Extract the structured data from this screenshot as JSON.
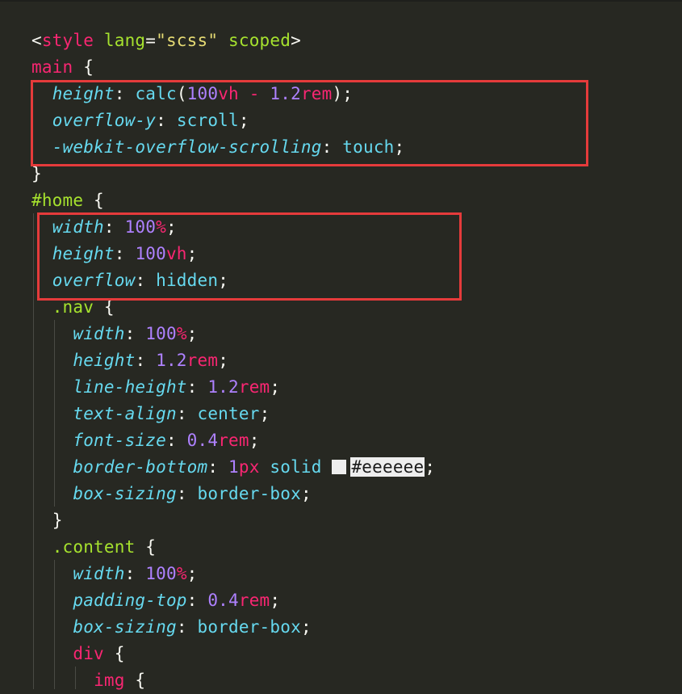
{
  "editor": {
    "colors": {
      "background": "#272822",
      "highlight_box": "#e53b3b",
      "swatch": "#eeeeee"
    },
    "lines": [
      [
        {
          "t": "<",
          "c": "punc"
        },
        {
          "t": "style",
          "c": "tag"
        },
        {
          "t": " ",
          "c": "punc"
        },
        {
          "t": "lang",
          "c": "attr"
        },
        {
          "t": "=",
          "c": "punc"
        },
        {
          "t": "\"scss\"",
          "c": "str"
        },
        {
          "t": " ",
          "c": "punc"
        },
        {
          "t": "scoped",
          "c": "attr"
        },
        {
          "t": ">",
          "c": "punc"
        }
      ],
      [
        {
          "t": "main",
          "c": "sel"
        },
        {
          "t": " {",
          "c": "punc"
        }
      ],
      [
        {
          "t": "  ",
          "c": "punc"
        },
        {
          "t": "height",
          "c": "prop"
        },
        {
          "t": ": ",
          "c": "punc"
        },
        {
          "t": "calc",
          "c": "kw"
        },
        {
          "t": "(",
          "c": "punc"
        },
        {
          "t": "100",
          "c": "num"
        },
        {
          "t": "vh",
          "c": "unit"
        },
        {
          "t": " - ",
          "c": "op"
        },
        {
          "t": "1.2",
          "c": "num"
        },
        {
          "t": "rem",
          "c": "unit"
        },
        {
          "t": ");",
          "c": "punc"
        }
      ],
      [
        {
          "t": "  ",
          "c": "punc"
        },
        {
          "t": "overflow-y",
          "c": "prop"
        },
        {
          "t": ": ",
          "c": "punc"
        },
        {
          "t": "scroll",
          "c": "kw"
        },
        {
          "t": ";",
          "c": "punc"
        }
      ],
      [
        {
          "t": "  ",
          "c": "punc"
        },
        {
          "t": "-webkit-overflow-scrolling",
          "c": "prop"
        },
        {
          "t": ": ",
          "c": "punc"
        },
        {
          "t": "touch",
          "c": "kw"
        },
        {
          "t": ";",
          "c": "punc"
        }
      ],
      [
        {
          "t": "}",
          "c": "punc"
        }
      ],
      [
        {
          "t": "#home",
          "c": "id"
        },
        {
          "t": " {",
          "c": "punc"
        }
      ],
      [
        {
          "t": "  ",
          "c": "punc"
        },
        {
          "t": "width",
          "c": "prop"
        },
        {
          "t": ": ",
          "c": "punc"
        },
        {
          "t": "100",
          "c": "num"
        },
        {
          "t": "%",
          "c": "unit"
        },
        {
          "t": ";",
          "c": "punc"
        }
      ],
      [
        {
          "t": "  ",
          "c": "punc"
        },
        {
          "t": "height",
          "c": "prop"
        },
        {
          "t": ": ",
          "c": "punc"
        },
        {
          "t": "100",
          "c": "num"
        },
        {
          "t": "vh",
          "c": "unit"
        },
        {
          "t": ";",
          "c": "punc"
        }
      ],
      [
        {
          "t": "  ",
          "c": "punc"
        },
        {
          "t": "overflow",
          "c": "prop"
        },
        {
          "t": ": ",
          "c": "punc"
        },
        {
          "t": "hidden",
          "c": "kw"
        },
        {
          "t": ";",
          "c": "punc"
        }
      ],
      [
        {
          "t": "  ",
          "c": "punc"
        },
        {
          "t": ".nav",
          "c": "cls"
        },
        {
          "t": " {",
          "c": "punc"
        }
      ],
      [
        {
          "t": "    ",
          "c": "punc"
        },
        {
          "t": "width",
          "c": "prop"
        },
        {
          "t": ": ",
          "c": "punc"
        },
        {
          "t": "100",
          "c": "num"
        },
        {
          "t": "%",
          "c": "unit"
        },
        {
          "t": ";",
          "c": "punc"
        }
      ],
      [
        {
          "t": "    ",
          "c": "punc"
        },
        {
          "t": "height",
          "c": "prop"
        },
        {
          "t": ": ",
          "c": "punc"
        },
        {
          "t": "1.2",
          "c": "num"
        },
        {
          "t": "rem",
          "c": "unit"
        },
        {
          "t": ";",
          "c": "punc"
        }
      ],
      [
        {
          "t": "    ",
          "c": "punc"
        },
        {
          "t": "line-height",
          "c": "prop"
        },
        {
          "t": ": ",
          "c": "punc"
        },
        {
          "t": "1.2",
          "c": "num"
        },
        {
          "t": "rem",
          "c": "unit"
        },
        {
          "t": ";",
          "c": "punc"
        }
      ],
      [
        {
          "t": "    ",
          "c": "punc"
        },
        {
          "t": "text-align",
          "c": "prop"
        },
        {
          "t": ": ",
          "c": "punc"
        },
        {
          "t": "center",
          "c": "kw"
        },
        {
          "t": ";",
          "c": "punc"
        }
      ],
      [
        {
          "t": "    ",
          "c": "punc"
        },
        {
          "t": "font-size",
          "c": "prop"
        },
        {
          "t": ": ",
          "c": "punc"
        },
        {
          "t": "0.4",
          "c": "num"
        },
        {
          "t": "rem",
          "c": "unit"
        },
        {
          "t": ";",
          "c": "punc"
        }
      ],
      [
        {
          "t": "    ",
          "c": "punc"
        },
        {
          "t": "border-bottom",
          "c": "prop"
        },
        {
          "t": ": ",
          "c": "punc"
        },
        {
          "t": "1",
          "c": "num"
        },
        {
          "t": "px",
          "c": "unit"
        },
        {
          "t": " ",
          "c": "punc"
        },
        {
          "t": "solid",
          "c": "kw"
        },
        {
          "t": " ",
          "c": "punc"
        },
        {
          "t": "",
          "c": "swatch"
        },
        {
          "t": "#eeeeee",
          "c": "hexbg"
        },
        {
          "t": ";",
          "c": "punc"
        }
      ],
      [
        {
          "t": "    ",
          "c": "punc"
        },
        {
          "t": "box-sizing",
          "c": "prop"
        },
        {
          "t": ": ",
          "c": "punc"
        },
        {
          "t": "border-box",
          "c": "kw"
        },
        {
          "t": ";",
          "c": "punc"
        }
      ],
      [
        {
          "t": "  ",
          "c": "punc"
        },
        {
          "t": "}",
          "c": "punc"
        }
      ],
      [
        {
          "t": "  ",
          "c": "punc"
        },
        {
          "t": ".content",
          "c": "cls"
        },
        {
          "t": " {",
          "c": "punc"
        }
      ],
      [
        {
          "t": "    ",
          "c": "punc"
        },
        {
          "t": "width",
          "c": "prop"
        },
        {
          "t": ": ",
          "c": "punc"
        },
        {
          "t": "100",
          "c": "num"
        },
        {
          "t": "%",
          "c": "unit"
        },
        {
          "t": ";",
          "c": "punc"
        }
      ],
      [
        {
          "t": "    ",
          "c": "punc"
        },
        {
          "t": "padding-top",
          "c": "prop"
        },
        {
          "t": ": ",
          "c": "punc"
        },
        {
          "t": "0.4",
          "c": "num"
        },
        {
          "t": "rem",
          "c": "unit"
        },
        {
          "t": ";",
          "c": "punc"
        }
      ],
      [
        {
          "t": "    ",
          "c": "punc"
        },
        {
          "t": "box-sizing",
          "c": "prop"
        },
        {
          "t": ": ",
          "c": "punc"
        },
        {
          "t": "border-box",
          "c": "kw"
        },
        {
          "t": ";",
          "c": "punc"
        }
      ],
      [
        {
          "t": "    ",
          "c": "punc"
        },
        {
          "t": "div",
          "c": "sel"
        },
        {
          "t": " {",
          "c": "punc"
        }
      ],
      [
        {
          "t": "      ",
          "c": "punc"
        },
        {
          "t": "img",
          "c": "sel"
        },
        {
          "t": " {",
          "c": "punc"
        }
      ]
    ]
  }
}
